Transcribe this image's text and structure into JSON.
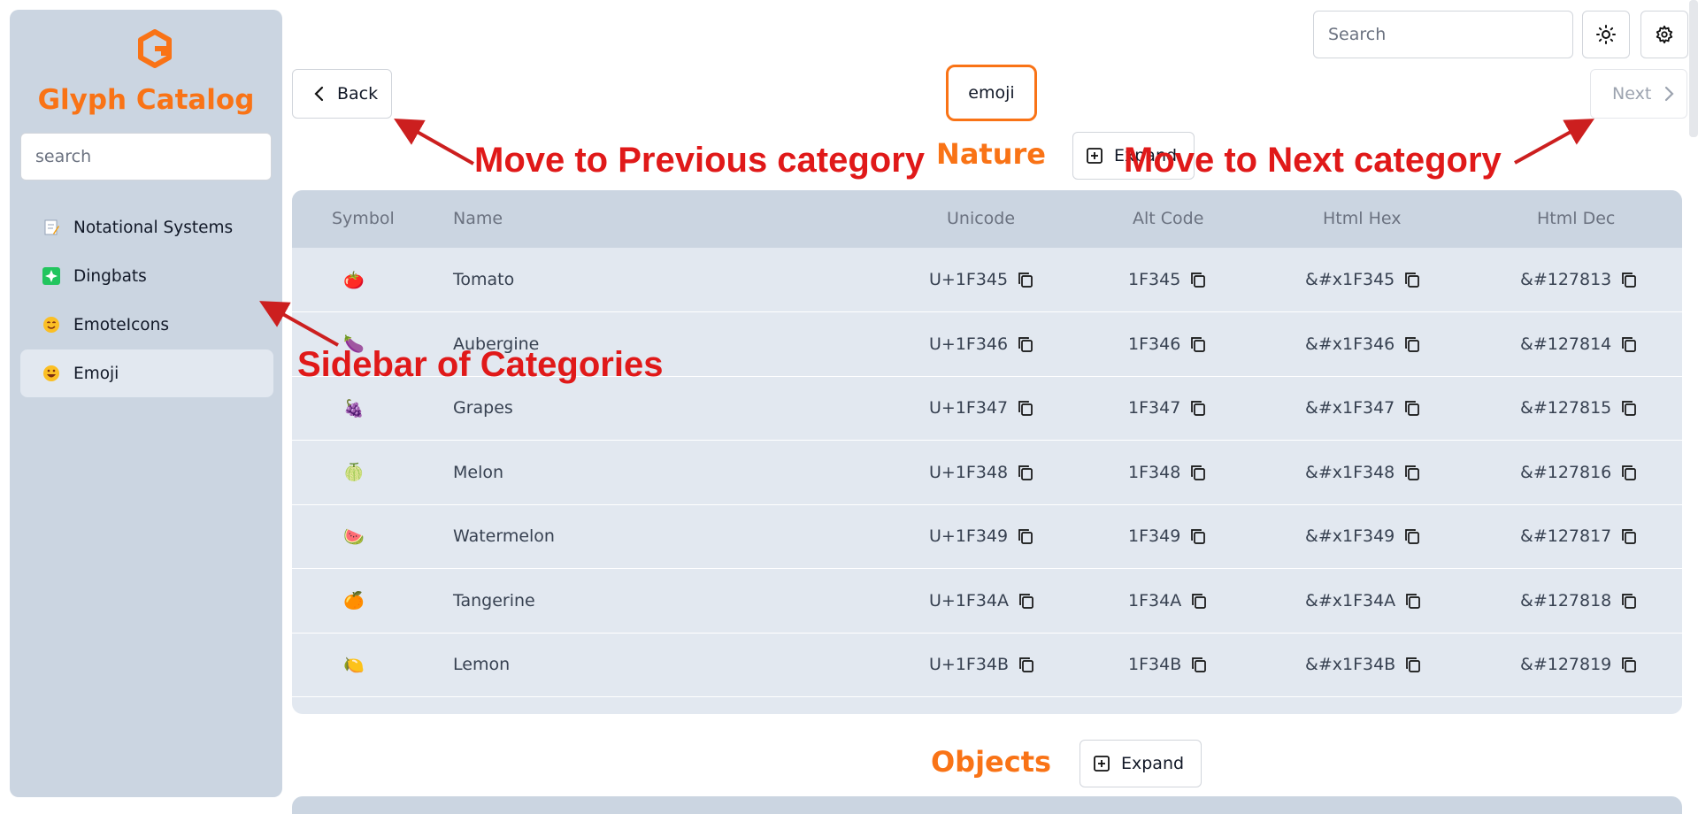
{
  "sidebar": {
    "brand": "Glyph Catalog",
    "search_placeholder": "search",
    "items": [
      {
        "label": "Notational Systems",
        "icon": "memo-emoji"
      },
      {
        "label": "Dingbats",
        "icon": "sparkle-emoji"
      },
      {
        "label": "EmoteIcons",
        "icon": "smile-emoji"
      },
      {
        "label": "Emoji",
        "icon": "grin-emoji",
        "active": true
      }
    ]
  },
  "topbar": {
    "search_placeholder": "Search",
    "theme_icon": "sun-icon",
    "settings_icon": "gear-icon"
  },
  "nav": {
    "back_label": "Back",
    "next_label": "Next",
    "current_category": "emoji"
  },
  "sections": [
    {
      "title": "Nature",
      "expand_label": "Expand"
    },
    {
      "title": "Objects",
      "expand_label": "Expand"
    }
  ],
  "table": {
    "columns": [
      "Symbol",
      "Name",
      "Unicode",
      "Alt Code",
      "Html Hex",
      "Html Dec"
    ],
    "rows": [
      {
        "symbol": "🍅",
        "name": "Tomato",
        "unicode": "U+1F345",
        "alt": "1F345",
        "hex": "&#x1F345",
        "dec": "&#127813"
      },
      {
        "symbol": "🍆",
        "name": "Aubergine",
        "unicode": "U+1F346",
        "alt": "1F346",
        "hex": "&#x1F346",
        "dec": "&#127814"
      },
      {
        "symbol": "🍇",
        "name": "Grapes",
        "unicode": "U+1F347",
        "alt": "1F347",
        "hex": "&#x1F347",
        "dec": "&#127815"
      },
      {
        "symbol": "🍈",
        "name": "Melon",
        "unicode": "U+1F348",
        "alt": "1F348",
        "hex": "&#x1F348",
        "dec": "&#127816"
      },
      {
        "symbol": "🍉",
        "name": "Watermelon",
        "unicode": "U+1F349",
        "alt": "1F349",
        "hex": "&#x1F349",
        "dec": "&#127817"
      },
      {
        "symbol": "🍊",
        "name": "Tangerine",
        "unicode": "U+1F34A",
        "alt": "1F34A",
        "hex": "&#x1F34A",
        "dec": "&#127818"
      },
      {
        "symbol": "🍋",
        "name": "Lemon",
        "unicode": "U+1F34B",
        "alt": "1F34B",
        "hex": "&#x1F34B",
        "dec": "&#127819"
      }
    ]
  },
  "annotations": {
    "prev": "Move to Previous category",
    "next": "Move to Next category",
    "sidebar": "Sidebar of Categories"
  },
  "colors": {
    "accent": "#f97316",
    "annotation": "#e01919",
    "sidebar_bg": "#cbd5e1",
    "table_bg": "#e2e8f0"
  }
}
